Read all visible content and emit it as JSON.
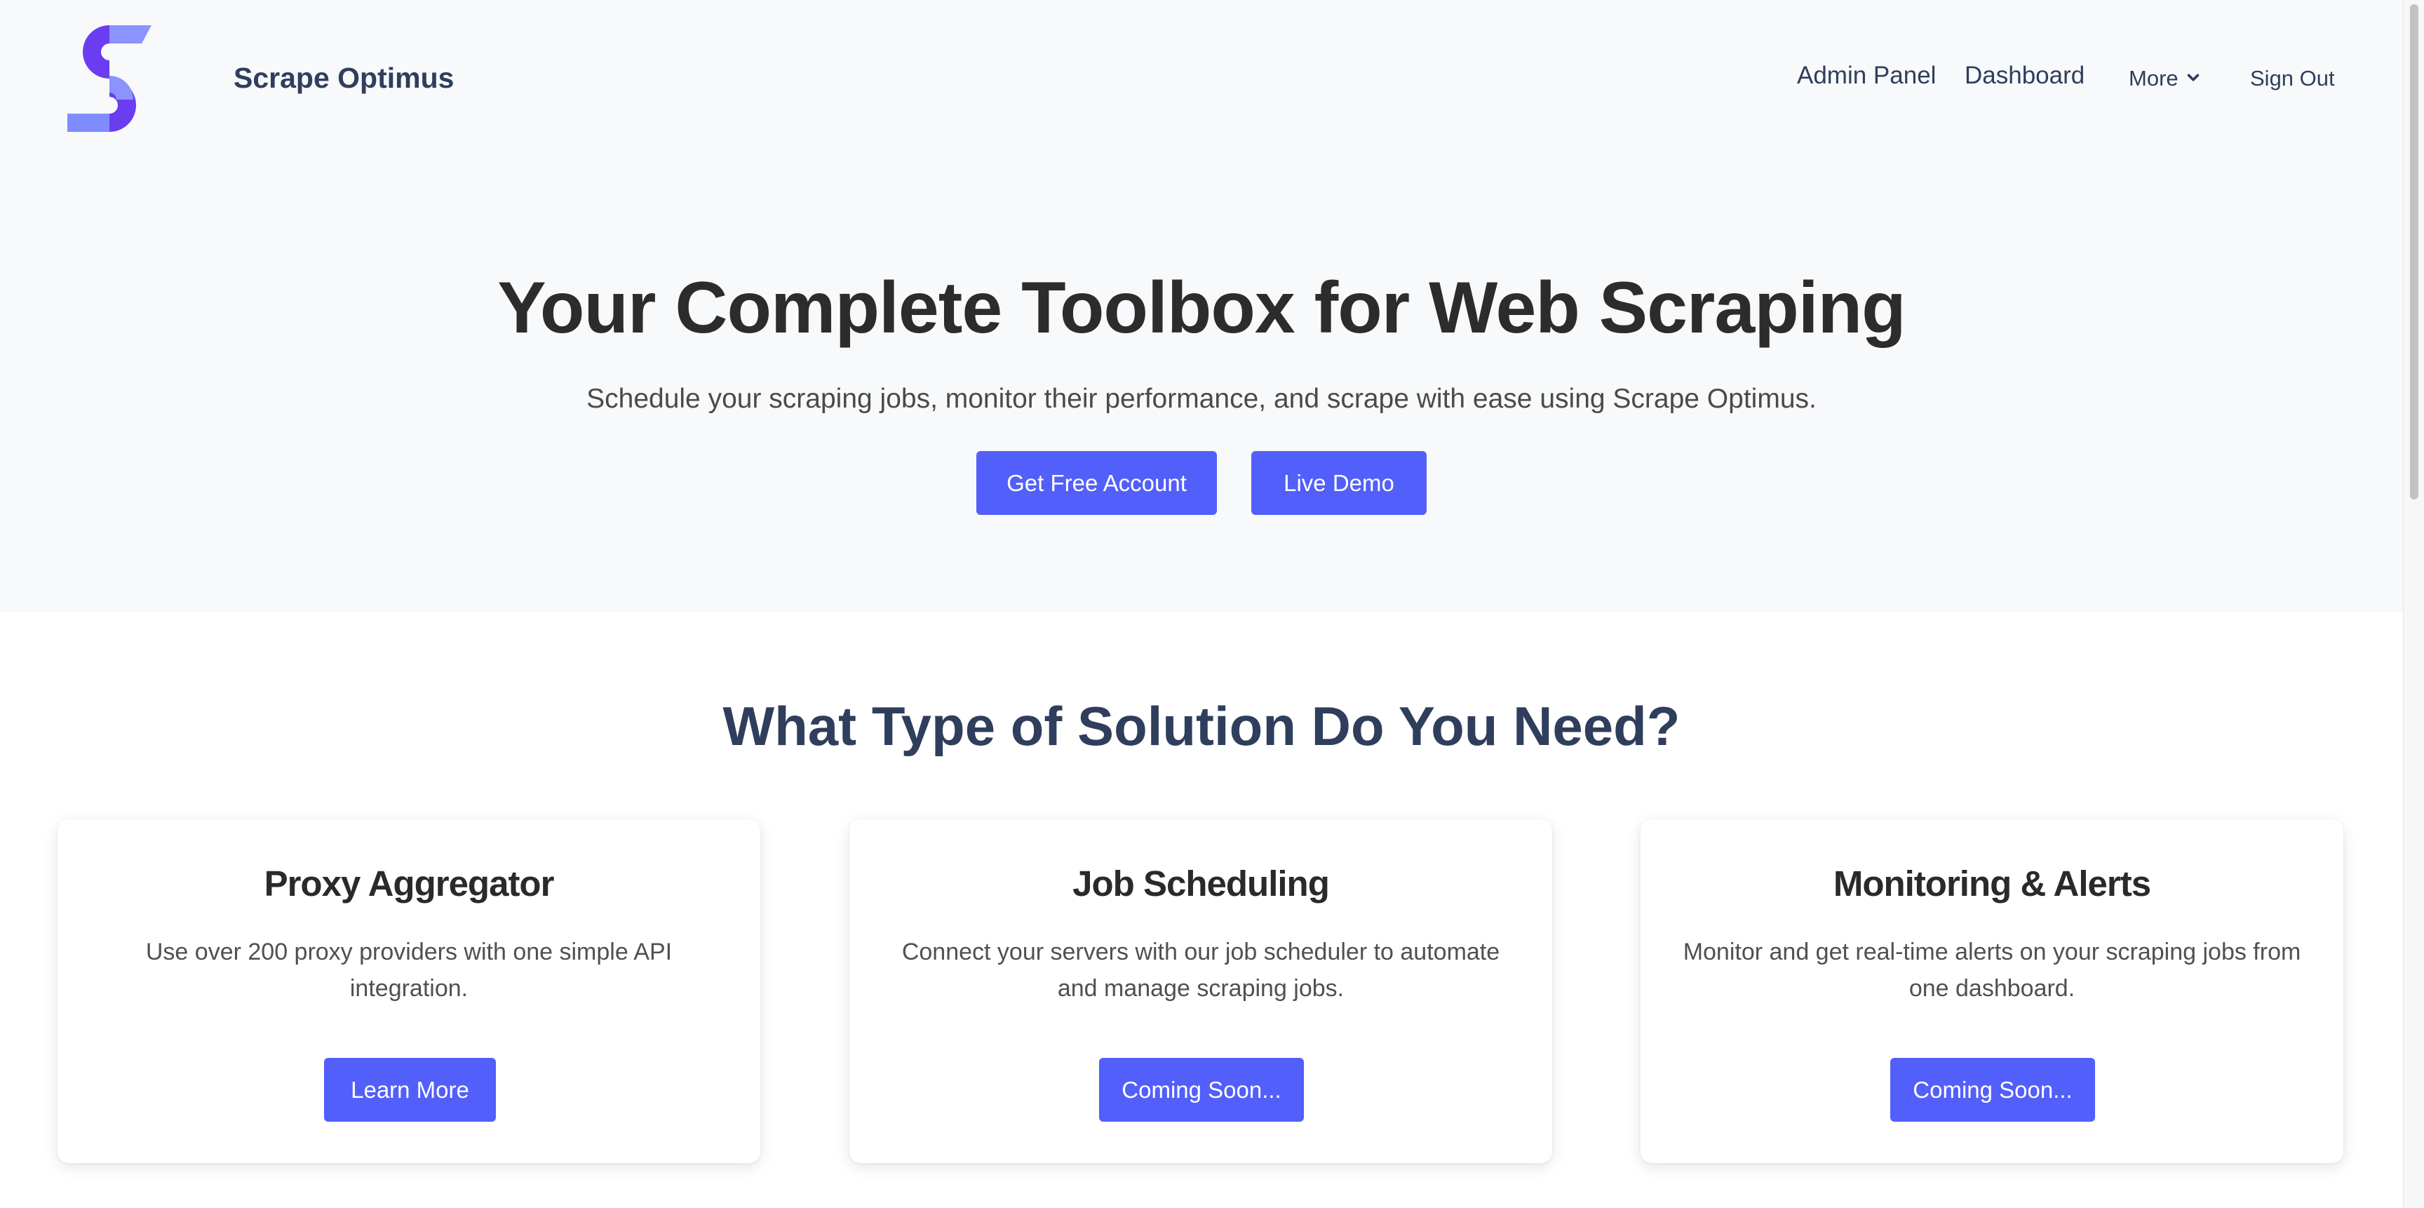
{
  "brand": {
    "name": "Scrape Optimus",
    "logo_icon": "scrape-optimus-s-logo"
  },
  "nav": {
    "admin_panel": "Admin Panel",
    "dashboard": "Dashboard",
    "more": "More",
    "sign_out": "Sign Out"
  },
  "hero": {
    "title": "Your Complete Toolbox for Web Scraping",
    "subtitle": "Schedule your scraping jobs, monitor their performance, and scrape with ease using Scrape Optimus.",
    "primary_button": "Get Free Account",
    "secondary_button": "Live Demo"
  },
  "solutions": {
    "title": "What Type of Solution Do You Need?",
    "cards": [
      {
        "title": "Proxy Aggregator",
        "text": "Use over 200 proxy providers with one simple API integration.",
        "button": "Learn More"
      },
      {
        "title": "Job Scheduling",
        "text": "Connect your servers with our job scheduler to automate and manage scraping jobs.",
        "button": "Coming Soon..."
      },
      {
        "title": "Monitoring & Alerts",
        "text": "Monitor and get real-time alerts on your scraping jobs from one dashboard.",
        "button": "Coming Soon..."
      }
    ]
  },
  "colors": {
    "accent": "#525ffa",
    "heading": "#2f3e5c",
    "hero_background": "#f8f9fb",
    "logo_primary": "#6a3df0",
    "logo_secondary": "#7f8cff"
  }
}
